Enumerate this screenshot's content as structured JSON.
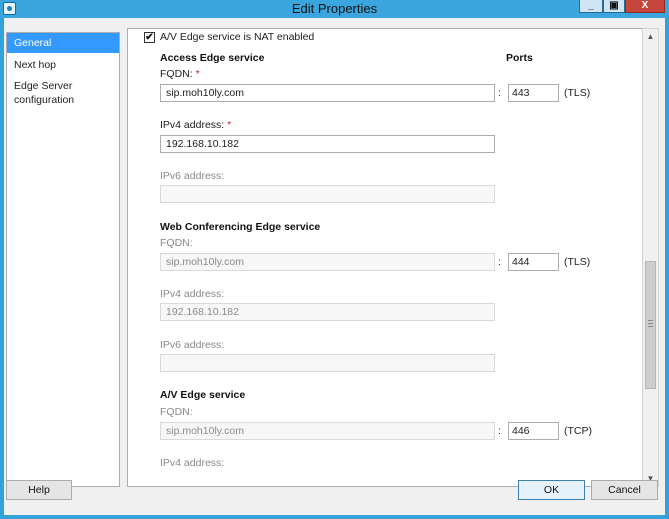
{
  "window": {
    "title": "Edit Properties"
  },
  "titlebar_buttons": {
    "minimize": "_",
    "maximize": "▣",
    "close": "X"
  },
  "nav": {
    "items": [
      {
        "label": "General"
      },
      {
        "label": "Next hop"
      },
      {
        "label": "Edge Server configuration"
      }
    ],
    "selected_index": 0
  },
  "form": {
    "nat_checkbox": {
      "label": "A/V Edge service is NAT enabled",
      "checked": true,
      "mark": "✔"
    },
    "ports_header": "Ports",
    "access": {
      "title": "Access Edge service",
      "fqdn_label": "FQDN:",
      "fqdn_value": "sip.moh10ly.com",
      "port": "443",
      "protocol": "(TLS)",
      "ipv4_label": "IPv4 address:",
      "ipv4_value": "192.168.10.182",
      "ipv6_label": "IPv6 address:",
      "ipv6_value": ""
    },
    "web": {
      "title": "Web Conferencing Edge service",
      "fqdn_label": "FQDN:",
      "fqdn_value": "sip.moh10ly.com",
      "port": "444",
      "protocol": "(TLS)",
      "ipv4_label": "IPv4 address:",
      "ipv4_value": "192.168.10.182",
      "ipv6_label": "IPv6 address:",
      "ipv6_value": ""
    },
    "av": {
      "title": "A/V Edge service",
      "fqdn_label": "FQDN:",
      "fqdn_value": "sip.moh10ly.com",
      "port": "446",
      "protocol": "(TCP)",
      "ipv4_label": "IPv4 address:"
    },
    "required_mark": "*",
    "colon": ":"
  },
  "buttons": {
    "help": "Help",
    "ok": "OK",
    "cancel": "Cancel"
  },
  "scrollbar": {
    "up_arrow": "▲",
    "down_arrow": "▼"
  },
  "colors": {
    "title_bar": "#3aa6dd",
    "selection": "#3399ff",
    "close_button": "#c7463c"
  }
}
